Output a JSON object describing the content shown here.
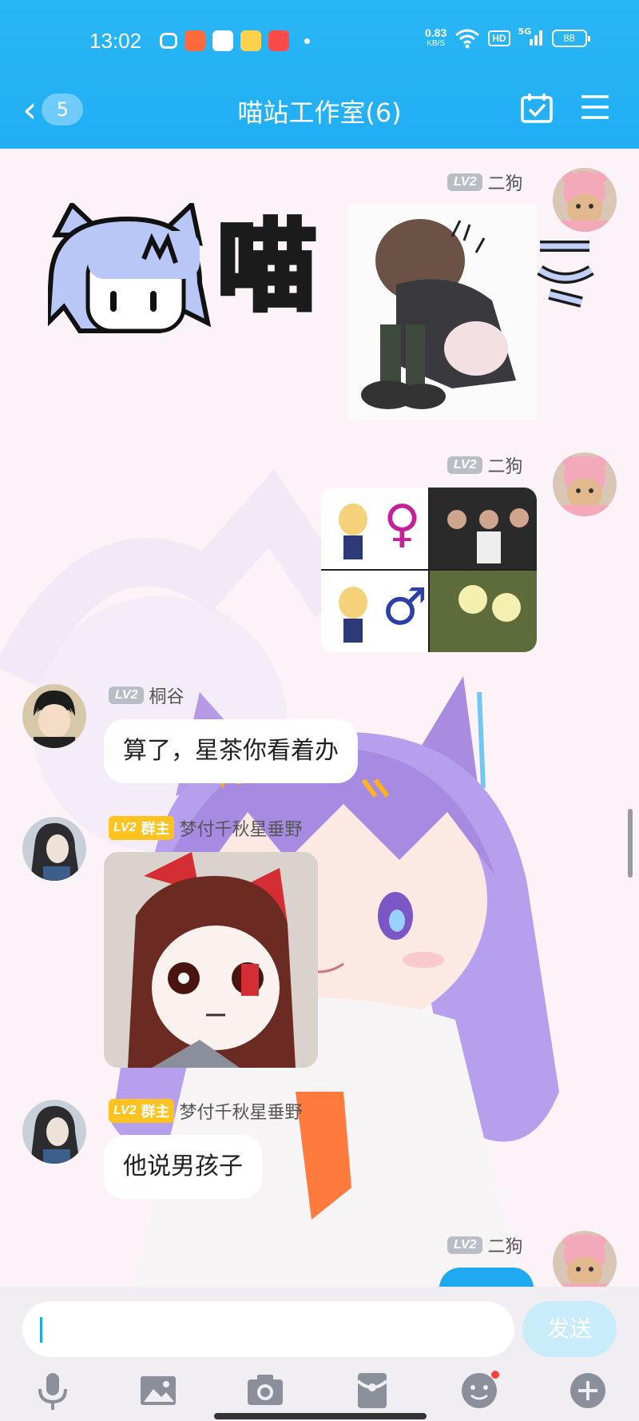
{
  "status_bar": {
    "time": "13:02",
    "net_speed": "0.83",
    "net_unit": "KB/S",
    "hd_label": "HD",
    "signal_label": "5G",
    "battery": "88"
  },
  "header": {
    "unread_count": "5",
    "title": "喵站工作室(6)",
    "back_icon": "chevron-left-icon",
    "calendar_icon": "calendar-check-icon",
    "menu_icon": "hamburger-menu-icon"
  },
  "messages": [
    {
      "sender": "二狗",
      "level": "LV2",
      "side": "right",
      "type": "image",
      "content_desc": "sticker"
    },
    {
      "sender": "二狗",
      "level": "LV2",
      "side": "right",
      "type": "image",
      "content_desc": "four-panel meme"
    },
    {
      "sender": "桐谷",
      "level": "LV2",
      "side": "left",
      "type": "text",
      "text": "算了，星茶你看着办"
    },
    {
      "sender": "梦付千秋星垂野",
      "level": "LV2",
      "role": "群主",
      "side": "left",
      "type": "image",
      "content_desc": "sticker"
    },
    {
      "sender": "梦付千秋星垂野",
      "level": "LV2",
      "role": "群主",
      "side": "left",
      "type": "text",
      "text": "他说男孩子"
    },
    {
      "sender": "二狗",
      "level": "LV2",
      "side": "right",
      "type": "text",
      "text": ""
    }
  ],
  "sticker_text": {
    "main": "喵",
    "gender_f": "♀",
    "gender_m": "♂"
  },
  "input_bar": {
    "placeholder": "",
    "send_label": "发送",
    "tools": [
      "microphone-icon",
      "image-icon",
      "camera-icon",
      "red-packet-icon",
      "emoji-icon",
      "plus-icon"
    ]
  },
  "colors": {
    "header": "#22aef3",
    "level_badge": "#b9bec6",
    "owner_badge": "#ffc21e",
    "send_button": "#c9ecfb"
  }
}
